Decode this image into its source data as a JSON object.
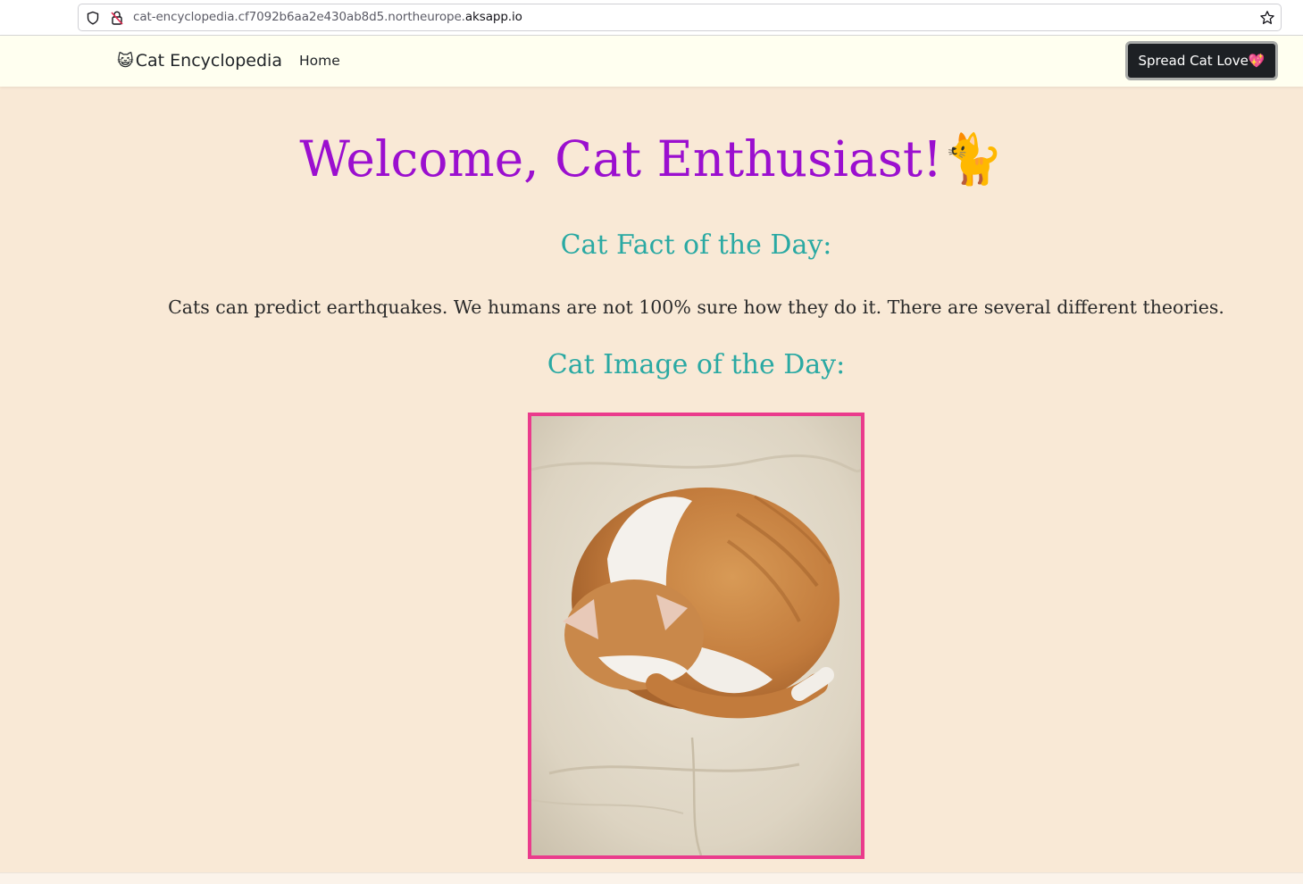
{
  "browser": {
    "url_prefix": "cat-encyclopedia.cf7092b6aa2e430ab8d5.northeurope.",
    "url_domain": "aksapp.io"
  },
  "navbar": {
    "brand_emoji": "😺",
    "brand_label": "Cat Encyclopedia",
    "home_label": "Home",
    "love_button_label": "Spread Cat Love💖"
  },
  "main": {
    "welcome_title": "Welcome, Cat Enthusiast!🐈",
    "fact_heading": "Cat Fact of the Day:",
    "fact_text": "Cats can predict earthquakes. We humans are not 100% sure how they do it. There are several different theories.",
    "image_heading": "Cat Image of the Day:"
  },
  "colors": {
    "page_background": "#f9e9d6",
    "navbar_background": "#fffff0",
    "welcome_color": "#9b0fcf",
    "heading_color": "#2aa9a3",
    "image_border": "#ea3b8c",
    "button_background": "#1d2024"
  },
  "icons": [
    "shield-icon",
    "insecure-lock-icon",
    "bookmark-star-icon"
  ]
}
